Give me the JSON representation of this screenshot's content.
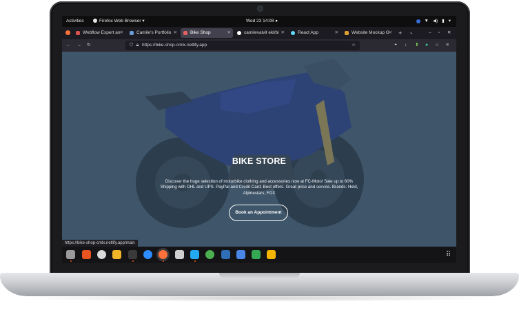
{
  "topbar": {
    "activities": "Activities",
    "app_menu": "Firefox Web Browser",
    "clock": "Wed 23  14:08"
  },
  "tabs": [
    {
      "title": "Webflow Expert an",
      "icon_color": "#d9534f"
    },
    {
      "title": "Camile's Portfolio",
      "icon_color": "#6a9bd8"
    },
    {
      "title": "Bike Shop",
      "icon_color": "#e06060",
      "active": true
    },
    {
      "title": "camilevalvit ekl/bi",
      "icon_color": "#ffffff"
    },
    {
      "title": "React App",
      "icon_color": "#61dafb"
    },
    {
      "title": "Website Mockup G",
      "icon_color": "#e0a030"
    }
  ],
  "address_bar": {
    "url": "https://bike-shop-cmlx.netlify.app"
  },
  "page": {
    "title": "BIKE STORE",
    "description": "Discover the huge selection of motorbike clothing and accessories now at FC-Moto! Sale up to 60% Shipping with DHL and UPS. PayPal and Credit Card. Best offers. Great price and service. Brands: Held, Alpinestars, FOX",
    "cta_label": "Book an Appointment"
  },
  "status_link": "https://bike-shop-cmlx.netlify.app/main",
  "dock": [
    {
      "name": "files",
      "color": "#9a9a9a"
    },
    {
      "name": "software",
      "color": "#e95420"
    },
    {
      "name": "chrome",
      "color": "#dadada"
    },
    {
      "name": "slack",
      "color": "#f0b429"
    },
    {
      "name": "terminal",
      "color": "#3a3a3a"
    },
    {
      "name": "zoom",
      "color": "#2d8cff"
    },
    {
      "name": "firefox",
      "color": "#ff7139"
    },
    {
      "name": "screenshot",
      "color": "#cfcfcf"
    },
    {
      "name": "vscode",
      "color": "#23a9f2"
    },
    {
      "name": "chrome-2",
      "color": "#4caf50"
    },
    {
      "name": "kite",
      "color": "#2e6fb7"
    },
    {
      "name": "docs",
      "color": "#4a86e8"
    },
    {
      "name": "sheets",
      "color": "#34a853"
    },
    {
      "name": "slides",
      "color": "#f4b400"
    },
    {
      "name": "inkscape",
      "color": "#d0d0d0"
    }
  ]
}
